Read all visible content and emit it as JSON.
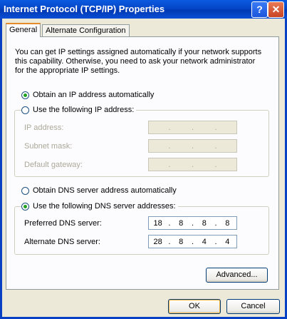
{
  "window": {
    "title": "Internet Protocol (TCP/IP) Properties",
    "help_glyph": "?",
    "close_glyph": "✕"
  },
  "tabs": [
    {
      "label": "General",
      "active": true
    },
    {
      "label": "Alternate Configuration",
      "active": false
    }
  ],
  "intro_text": "You can get IP settings assigned automatically if your network supports this capability. Otherwise, you need to ask your network administrator for the appropriate IP settings.",
  "ip_section": {
    "auto_label": "Obtain an IP address automatically",
    "auto_checked": true,
    "manual_label": "Use the following IP address:",
    "manual_checked": false,
    "fields": [
      {
        "label": "IP address:",
        "value": [
          "",
          "",
          "",
          ""
        ]
      },
      {
        "label": "Subnet mask:",
        "value": [
          "",
          "",
          "",
          ""
        ]
      },
      {
        "label": "Default gateway:",
        "value": [
          "",
          "",
          "",
          ""
        ]
      }
    ]
  },
  "dns_section": {
    "auto_label": "Obtain DNS server address automatically",
    "auto_checked": false,
    "manual_label": "Use the following DNS server addresses:",
    "manual_checked": true,
    "fields": [
      {
        "label": "Preferred DNS server:",
        "value": [
          "18",
          "8",
          "8",
          "8"
        ]
      },
      {
        "label": "Alternate DNS server:",
        "value": [
          "28",
          "8",
          "4",
          "4"
        ]
      }
    ]
  },
  "buttons": {
    "advanced": "Advanced...",
    "ok": "OK",
    "cancel": "Cancel"
  },
  "colors": {
    "titlebar": "#0546c8",
    "dialog_bg": "#ece9d8",
    "tab_accent": "#e68b2c",
    "radio_dot": "#21a121"
  }
}
